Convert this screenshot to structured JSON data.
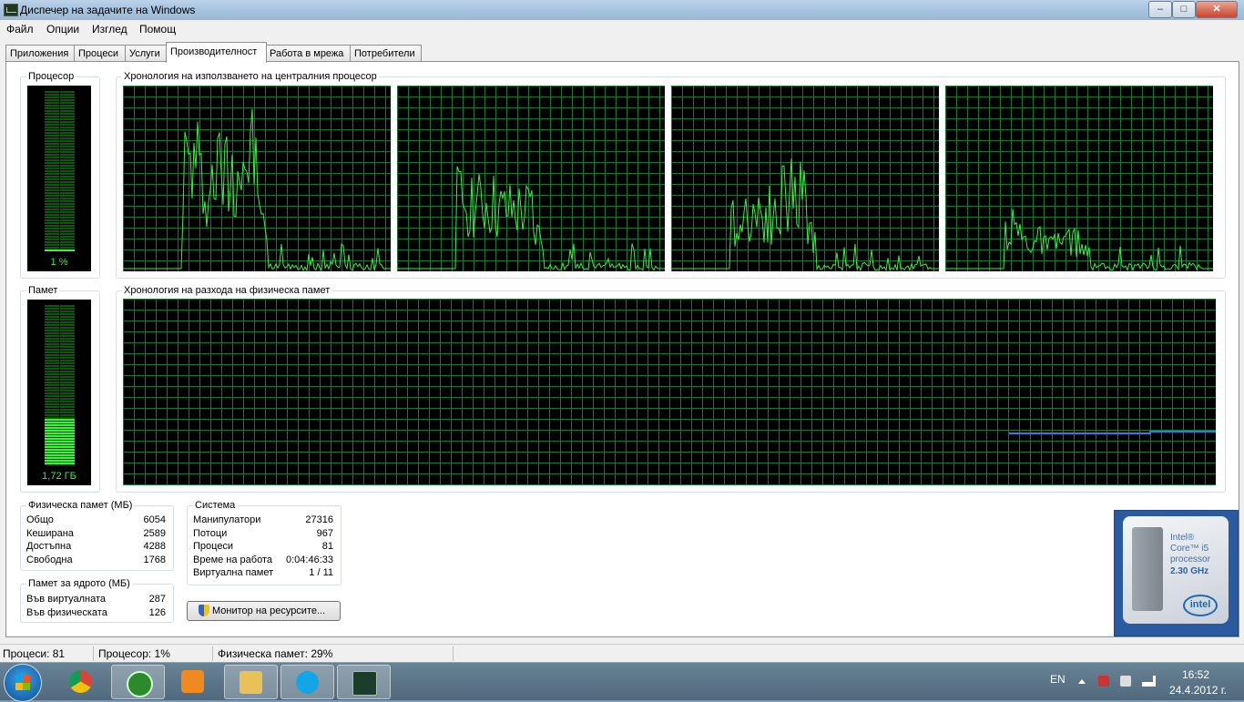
{
  "window": {
    "title": "Диспечер на задачите на Windows",
    "min": "–",
    "max": "□",
    "close": "✕"
  },
  "menu": [
    "Файл",
    "Опции",
    "Изглед",
    "Помощ"
  ],
  "tabs": [
    "Приложения",
    "Процеси",
    "Услуги",
    "Производителност",
    "Работа в мрежа",
    "Потребители"
  ],
  "active_tab": "Производителност",
  "cpu": {
    "meter_label": "Процесор",
    "usage_text": "1 %",
    "usage_fraction": 0.01,
    "history_label": "Хронология на използването на централния процесор",
    "cores": 4
  },
  "memory": {
    "meter_label": "Памет",
    "usage_text": "1,72 ГБ",
    "usage_fraction": 0.29,
    "history_label": "Хронология на разхода на физическа памет"
  },
  "physical_memory": {
    "title": "Физическа памет (МБ)",
    "rows": [
      {
        "label": "Общо",
        "value": "6054"
      },
      {
        "label": "Кеширана",
        "value": "2589"
      },
      {
        "label": "Достъпна",
        "value": "4288"
      },
      {
        "label": "Свободна",
        "value": "1768"
      }
    ]
  },
  "kernel_memory": {
    "title": "Памет за ядрото (МБ)",
    "rows": [
      {
        "label": "Във виртуалната",
        "value": "287"
      },
      {
        "label": "Във физическата",
        "value": "126"
      }
    ]
  },
  "system": {
    "title": "Система",
    "rows": [
      {
        "label": "Манипулатори",
        "value": "27316"
      },
      {
        "label": "Потоци",
        "value": "967"
      },
      {
        "label": "Процеси",
        "value": "81"
      },
      {
        "label": "Време на работа",
        "value": "0:04:46:33"
      },
      {
        "label": "Виртуална памет",
        "value": "1 / 11"
      }
    ]
  },
  "resource_monitor_button": "Монитор на ресурсите...",
  "statusbar": {
    "processes": "Процеси: 81",
    "cpu": "Процесор: 1%",
    "memory": "Физическа памет: 29%"
  },
  "intel": {
    "line1": "Intel®",
    "line2": "Core™ i5",
    "line3": "processor",
    "line4": "2.30 GHz",
    "logo": "intel"
  },
  "taskbar": {
    "apps": [
      "start-icon",
      "chrome-icon",
      "utorrent-icon",
      "media-player-icon",
      "explorer-icon",
      "skype-icon",
      "task-manager-icon"
    ],
    "language": "EN",
    "time": "16:52",
    "date": "24.4.2012 г."
  },
  "colors": {
    "graph_line": "#3cf03c",
    "grid": "#0f7a3c",
    "memory_line": "#2a7fe0",
    "titlebar": "#a6c2de"
  }
}
